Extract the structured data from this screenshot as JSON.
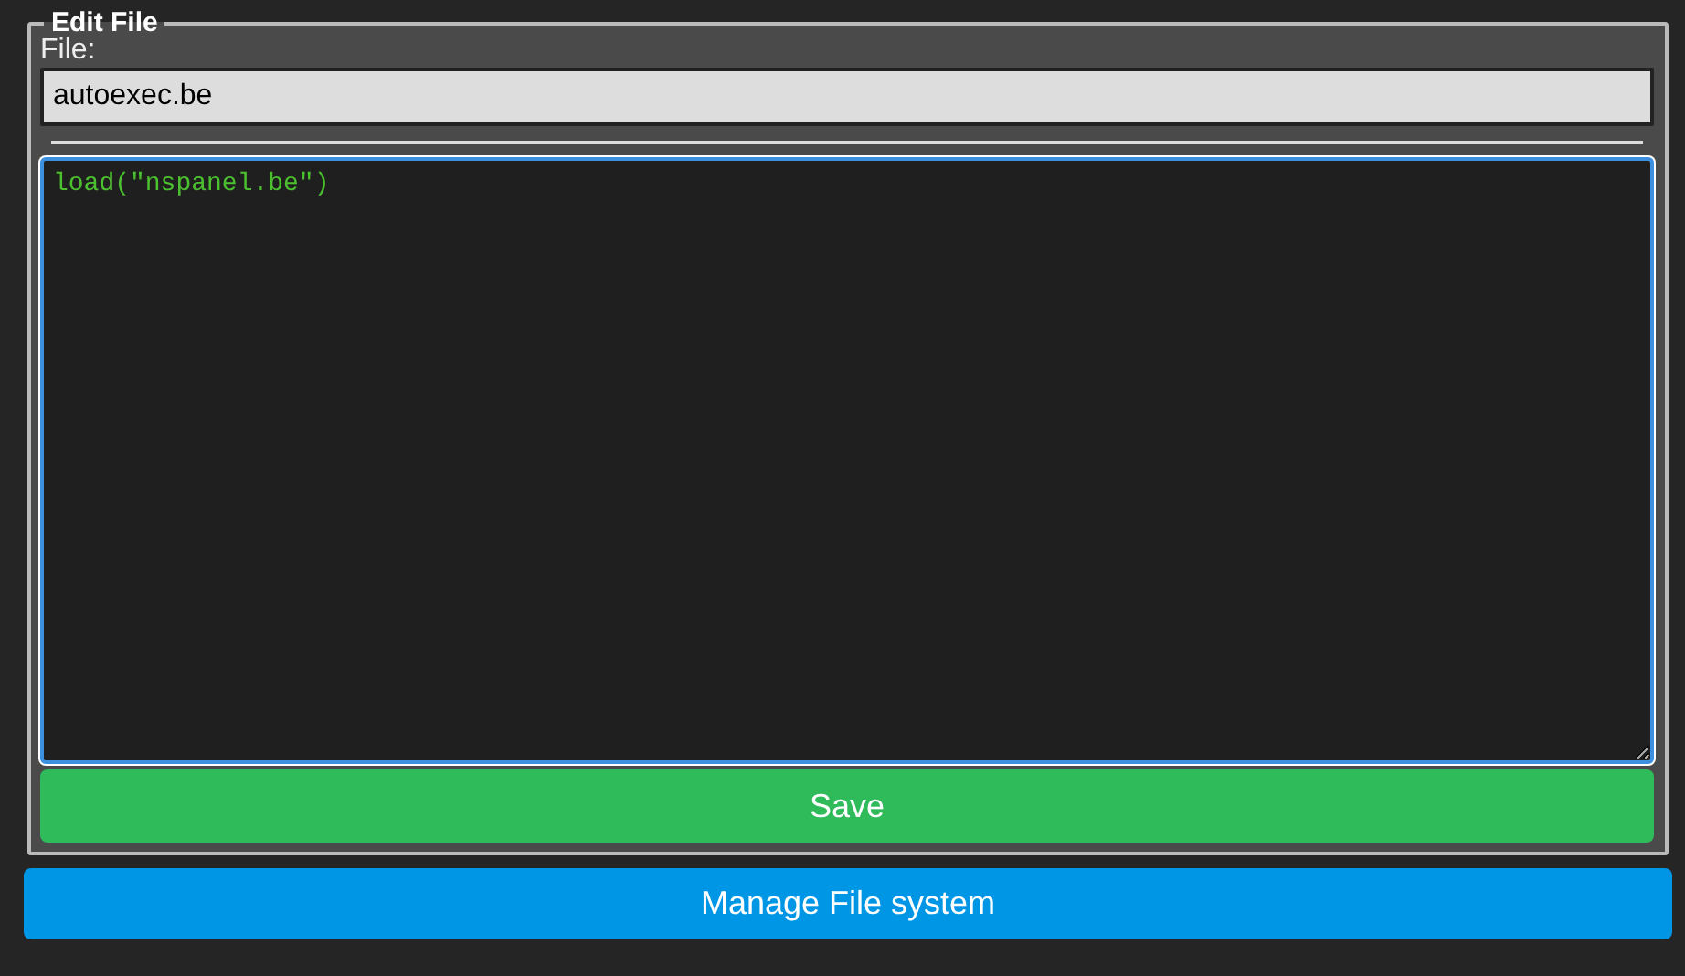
{
  "fieldset": {
    "legend": "Edit File",
    "file_label": "File:",
    "file_name": "autoexec.be",
    "editor": {
      "value": "load(\"nspanel.be\")",
      "focused": true
    },
    "save_button": "Save"
  },
  "manage_button": "Manage File system"
}
